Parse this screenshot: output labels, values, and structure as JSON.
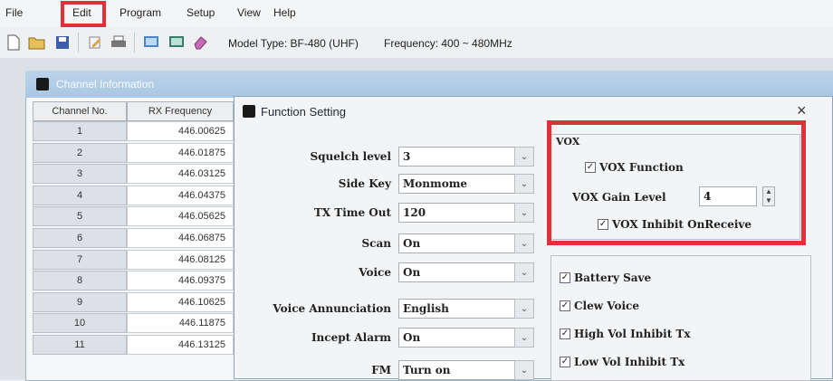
{
  "menu": [
    "File",
    "Edit",
    "Program",
    "Setup",
    "View",
    "Help"
  ],
  "toolbar": {
    "model_label": "Model Type: BF-480 (UHF)",
    "freq_label": "Frequency: 400 ~ 480MHz",
    "icons": [
      "new-icon",
      "open-icon",
      "save-icon",
      "edit-icon",
      "print-icon",
      "read-icon",
      "write-icon",
      "eraser-icon"
    ]
  },
  "channel_window": {
    "title": "Channel Information",
    "columns": [
      "Channel No.",
      "RX Frequency"
    ],
    "rows": [
      {
        "no": "1",
        "rx": "446.00625"
      },
      {
        "no": "2",
        "rx": "446.01875"
      },
      {
        "no": "3",
        "rx": "446.03125"
      },
      {
        "no": "4",
        "rx": "446.04375"
      },
      {
        "no": "5",
        "rx": "446.05625"
      },
      {
        "no": "6",
        "rx": "446.06875"
      },
      {
        "no": "7",
        "rx": "446.08125"
      },
      {
        "no": "8",
        "rx": "446.09375"
      },
      {
        "no": "9",
        "rx": "446.10625"
      },
      {
        "no": "10",
        "rx": "446.11875"
      },
      {
        "no": "11",
        "rx": "446.13125"
      }
    ]
  },
  "function_dialog": {
    "title": "Function Setting",
    "close": "×",
    "fields": [
      {
        "label": "Squelch level",
        "value": "3"
      },
      {
        "label": "Side Key",
        "value": "Monmome"
      },
      {
        "label": "TX Time Out",
        "value": "120"
      },
      {
        "label": "Scan",
        "value": "On"
      },
      {
        "label": "Voice",
        "value": "On"
      },
      {
        "label": "Voice Annunciation",
        "value": "English"
      },
      {
        "label": "Incept Alarm",
        "value": "On"
      },
      {
        "label": "FM",
        "value": "Turn on"
      }
    ],
    "vox": {
      "group_label": "VOX",
      "function_label": "VOX Function",
      "gain_label": "VOX Gain Level",
      "gain_value": "4",
      "inhibit_label": "VOX Inhibit OnReceive"
    },
    "options": [
      "Battery Save",
      "Clew Voice",
      "High Vol Inhibit Tx",
      "Low Vol Inhibit Tx"
    ]
  },
  "colors": {
    "highlight": "#e0313a",
    "titlebar": "#a9c6e3"
  }
}
